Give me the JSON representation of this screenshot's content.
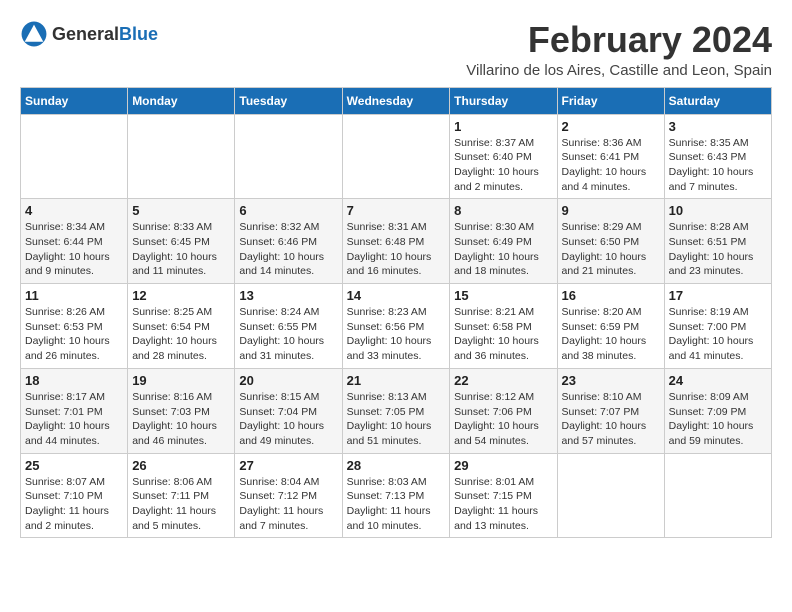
{
  "header": {
    "logo_general": "General",
    "logo_blue": "Blue",
    "month_year": "February 2024",
    "location": "Villarino de los Aires, Castille and Leon, Spain"
  },
  "weekdays": [
    "Sunday",
    "Monday",
    "Tuesday",
    "Wednesday",
    "Thursday",
    "Friday",
    "Saturday"
  ],
  "weeks": [
    [
      {
        "day": "",
        "info": ""
      },
      {
        "day": "",
        "info": ""
      },
      {
        "day": "",
        "info": ""
      },
      {
        "day": "",
        "info": ""
      },
      {
        "day": "1",
        "info": "Sunrise: 8:37 AM\nSunset: 6:40 PM\nDaylight: 10 hours and 2 minutes."
      },
      {
        "day": "2",
        "info": "Sunrise: 8:36 AM\nSunset: 6:41 PM\nDaylight: 10 hours and 4 minutes."
      },
      {
        "day": "3",
        "info": "Sunrise: 8:35 AM\nSunset: 6:43 PM\nDaylight: 10 hours and 7 minutes."
      }
    ],
    [
      {
        "day": "4",
        "info": "Sunrise: 8:34 AM\nSunset: 6:44 PM\nDaylight: 10 hours and 9 minutes."
      },
      {
        "day": "5",
        "info": "Sunrise: 8:33 AM\nSunset: 6:45 PM\nDaylight: 10 hours and 11 minutes."
      },
      {
        "day": "6",
        "info": "Sunrise: 8:32 AM\nSunset: 6:46 PM\nDaylight: 10 hours and 14 minutes."
      },
      {
        "day": "7",
        "info": "Sunrise: 8:31 AM\nSunset: 6:48 PM\nDaylight: 10 hours and 16 minutes."
      },
      {
        "day": "8",
        "info": "Sunrise: 8:30 AM\nSunset: 6:49 PM\nDaylight: 10 hours and 18 minutes."
      },
      {
        "day": "9",
        "info": "Sunrise: 8:29 AM\nSunset: 6:50 PM\nDaylight: 10 hours and 21 minutes."
      },
      {
        "day": "10",
        "info": "Sunrise: 8:28 AM\nSunset: 6:51 PM\nDaylight: 10 hours and 23 minutes."
      }
    ],
    [
      {
        "day": "11",
        "info": "Sunrise: 8:26 AM\nSunset: 6:53 PM\nDaylight: 10 hours and 26 minutes."
      },
      {
        "day": "12",
        "info": "Sunrise: 8:25 AM\nSunset: 6:54 PM\nDaylight: 10 hours and 28 minutes."
      },
      {
        "day": "13",
        "info": "Sunrise: 8:24 AM\nSunset: 6:55 PM\nDaylight: 10 hours and 31 minutes."
      },
      {
        "day": "14",
        "info": "Sunrise: 8:23 AM\nSunset: 6:56 PM\nDaylight: 10 hours and 33 minutes."
      },
      {
        "day": "15",
        "info": "Sunrise: 8:21 AM\nSunset: 6:58 PM\nDaylight: 10 hours and 36 minutes."
      },
      {
        "day": "16",
        "info": "Sunrise: 8:20 AM\nSunset: 6:59 PM\nDaylight: 10 hours and 38 minutes."
      },
      {
        "day": "17",
        "info": "Sunrise: 8:19 AM\nSunset: 7:00 PM\nDaylight: 10 hours and 41 minutes."
      }
    ],
    [
      {
        "day": "18",
        "info": "Sunrise: 8:17 AM\nSunset: 7:01 PM\nDaylight: 10 hours and 44 minutes."
      },
      {
        "day": "19",
        "info": "Sunrise: 8:16 AM\nSunset: 7:03 PM\nDaylight: 10 hours and 46 minutes."
      },
      {
        "day": "20",
        "info": "Sunrise: 8:15 AM\nSunset: 7:04 PM\nDaylight: 10 hours and 49 minutes."
      },
      {
        "day": "21",
        "info": "Sunrise: 8:13 AM\nSunset: 7:05 PM\nDaylight: 10 hours and 51 minutes."
      },
      {
        "day": "22",
        "info": "Sunrise: 8:12 AM\nSunset: 7:06 PM\nDaylight: 10 hours and 54 minutes."
      },
      {
        "day": "23",
        "info": "Sunrise: 8:10 AM\nSunset: 7:07 PM\nDaylight: 10 hours and 57 minutes."
      },
      {
        "day": "24",
        "info": "Sunrise: 8:09 AM\nSunset: 7:09 PM\nDaylight: 10 hours and 59 minutes."
      }
    ],
    [
      {
        "day": "25",
        "info": "Sunrise: 8:07 AM\nSunset: 7:10 PM\nDaylight: 11 hours and 2 minutes."
      },
      {
        "day": "26",
        "info": "Sunrise: 8:06 AM\nSunset: 7:11 PM\nDaylight: 11 hours and 5 minutes."
      },
      {
        "day": "27",
        "info": "Sunrise: 8:04 AM\nSunset: 7:12 PM\nDaylight: 11 hours and 7 minutes."
      },
      {
        "day": "28",
        "info": "Sunrise: 8:03 AM\nSunset: 7:13 PM\nDaylight: 11 hours and 10 minutes."
      },
      {
        "day": "29",
        "info": "Sunrise: 8:01 AM\nSunset: 7:15 PM\nDaylight: 11 hours and 13 minutes."
      },
      {
        "day": "",
        "info": ""
      },
      {
        "day": "",
        "info": ""
      }
    ]
  ]
}
